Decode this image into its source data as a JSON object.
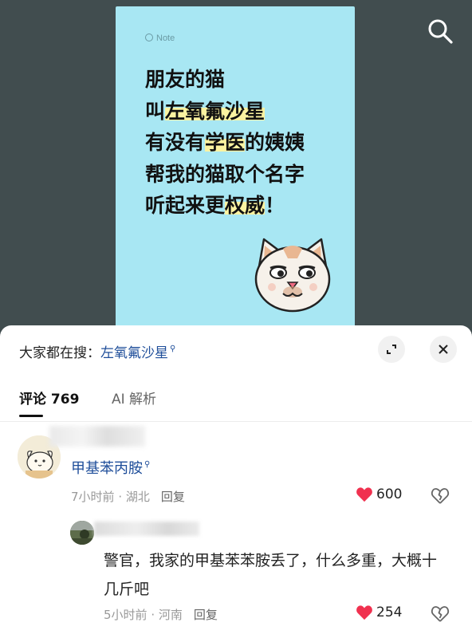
{
  "note": {
    "label": "Note",
    "lines": [
      {
        "pre": "朋友的猫",
        "hl": "",
        "post": ""
      },
      {
        "pre": "叫",
        "hl": "左氧氟沙星",
        "post": ""
      },
      {
        "pre": "有没有",
        "hl": "学医",
        "post": "的姨姨"
      },
      {
        "pre": "帮我的猫取个名字",
        "hl": "",
        "post": ""
      },
      {
        "pre": "听起来更",
        "hl": "权威",
        "post": "！"
      }
    ],
    "card_color": "#a8e7f3",
    "highlight_color": "#fbf3a1"
  },
  "search_bar": {
    "prefix": "大家都在搜：",
    "keyword": "左氧氟沙星",
    "icon": "search-icon"
  },
  "tabs": {
    "comments": "评论 769",
    "ai": "AI 解析"
  },
  "comments": [
    {
      "text": "甲基苯丙胺",
      "time": "7小时前",
      "location": "湖北",
      "reply": "回复",
      "likes": "600"
    },
    {
      "text": "警官，我家的甲基苯苯胺丢了，什么多重，大概十几斤吧",
      "time": "5小时前",
      "location": "河南",
      "reply": "回复",
      "likes": "254"
    }
  ],
  "colors": {
    "link_blue": "#1f4e9a",
    "like_red": "#f0314f",
    "background": "#414d4f"
  }
}
